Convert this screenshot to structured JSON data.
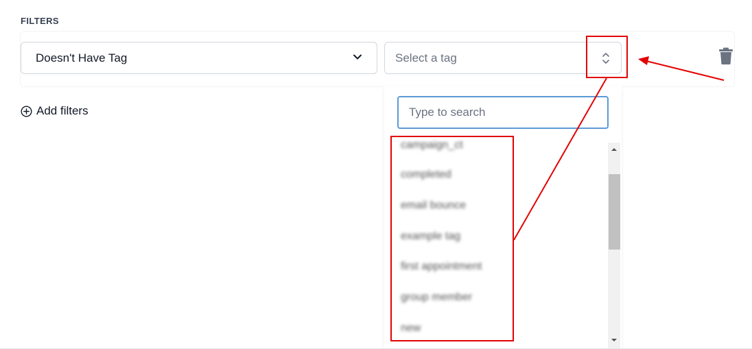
{
  "filters_heading": "FILTERS",
  "condition_select": {
    "value": "Doesn't Have Tag",
    "icon": "chevron-down-icon"
  },
  "tag_select": {
    "placeholder": "Select a tag",
    "icon": "chevron-up-down-icon"
  },
  "delete_icon": "trash-icon",
  "add_filters": {
    "label": "Add filters",
    "icon": "plus-circle-icon"
  },
  "dropdown": {
    "search_placeholder": "Type to search",
    "options": [
      "campaign_ct",
      "completed",
      "email bounce",
      "example tag",
      "first appointment",
      "group member",
      "new"
    ],
    "options_blurred": true
  },
  "annotation_color": "#e30000"
}
